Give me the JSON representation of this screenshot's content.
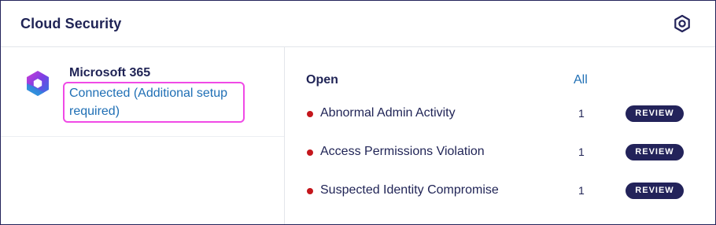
{
  "widget": {
    "title": "Cloud Security",
    "settings_icon": "hexagon-settings-icon"
  },
  "tenant": {
    "icon": "microsoft-365-logo",
    "name": "Microsoft 365",
    "status": "Connected (Additional setup required)"
  },
  "alerts": {
    "heading": "Open",
    "all_link": "All",
    "items": [
      {
        "label": "Abnormal Admin Activity",
        "count": "1",
        "action": "REVIEW"
      },
      {
        "label": "Access Permissions Violation",
        "count": "1",
        "action": "REVIEW"
      },
      {
        "label": "Suspected Identity Compromise",
        "count": "1",
        "action": "REVIEW"
      }
    ]
  },
  "colors": {
    "navy": "#1f2355",
    "link_blue": "#1f6fb5",
    "alert_red": "#c4161c",
    "highlight_magenta": "#f04ae6",
    "badge_navy": "#23235a"
  }
}
